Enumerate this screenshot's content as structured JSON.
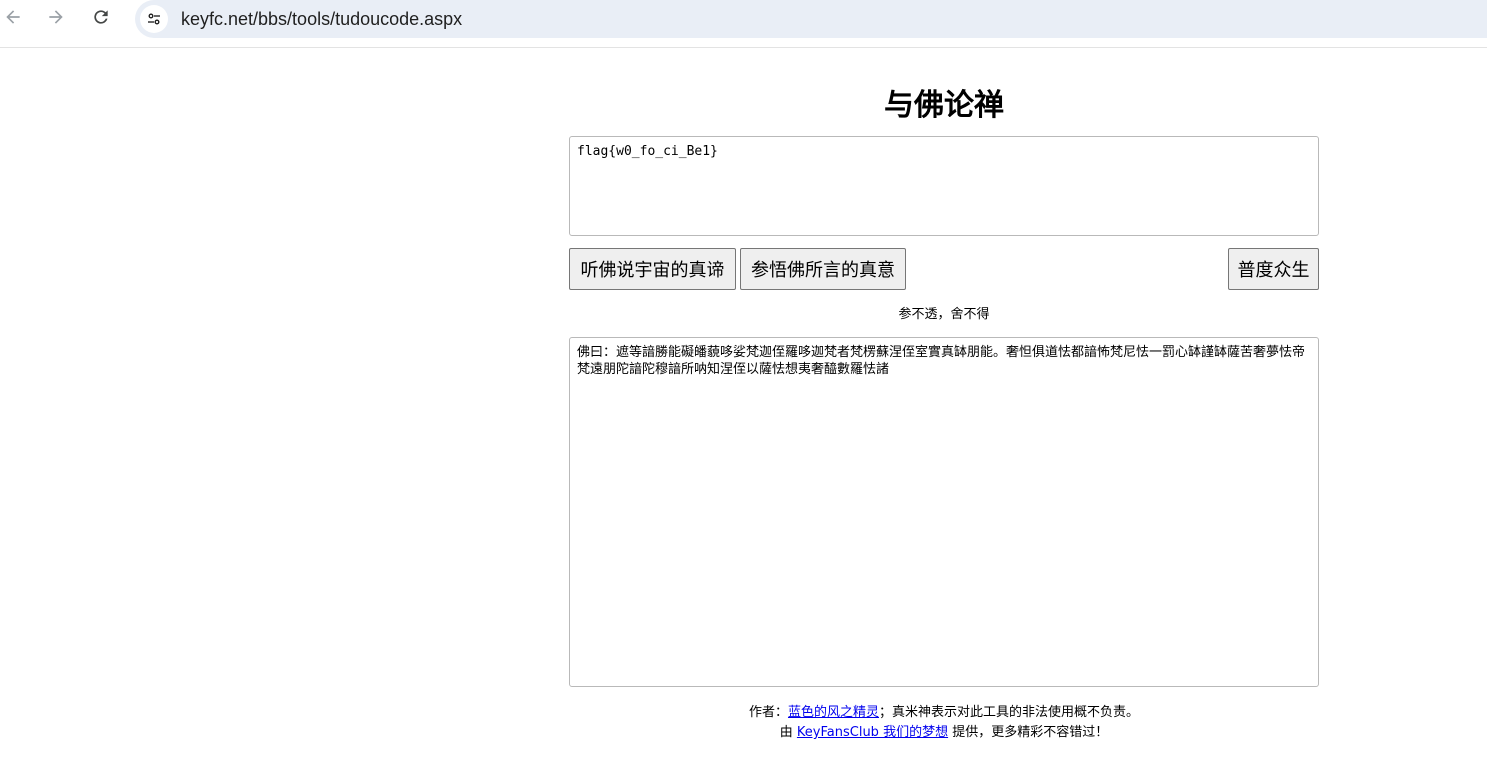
{
  "browser": {
    "url": "keyfc.net/bbs/tools/tudoucode.aspx",
    "icons": {
      "back": "arrow-left-icon",
      "forward": "arrow-right-icon",
      "reload": "reload-icon",
      "site_info": "tune-icon"
    }
  },
  "page": {
    "title": "与佛论禅",
    "input_text": "flag{w0_fo_ci_Be1}",
    "buttons": {
      "encode": "听佛说宇宙的真谛",
      "decode": "参悟佛所言的真意",
      "clear": "普度众生"
    },
    "slogan": "参不透，舍不得",
    "output_text": "佛曰：遮等諳勝能礙皤藐哆娑梵迦侄羅哆迦梵者梵楞蘇涅侄室實真缽朋能。奢怛俱道怯都諳怖梵尼怯一罰心缽謹缽薩苦奢夢怯帝梵遠朋陀諳陀穆諳所呐知涅侄以薩怯想夷奢醯數羅怯諸",
    "footer": {
      "author_prefix": "作者：",
      "author_link": "蓝色的风之精灵",
      "author_suffix": "；真米神表示对此工具的非法使用概不负责。",
      "provided_prefix": "由 ",
      "provided_link": "KeyFansClub 我们的梦想",
      "provided_suffix": " 提供，更多精彩不容错过！"
    }
  },
  "colors": {
    "link": "#0000ee",
    "omnibox_bg": "#e9eef6",
    "button_bg": "#efefef"
  }
}
